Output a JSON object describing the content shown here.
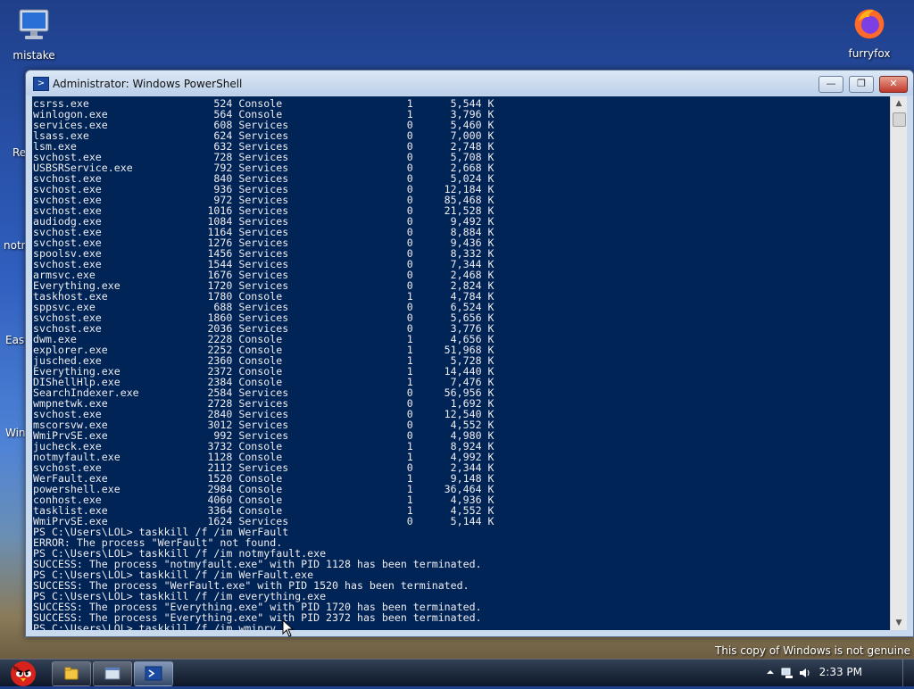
{
  "desktop": {
    "icons": [
      {
        "label": "mistake"
      },
      {
        "label": "furryfox"
      }
    ],
    "partial_labels": [
      "Re",
      "notn",
      "Easy",
      "Win"
    ],
    "genuine_notice": "This copy of Windows is not genuine"
  },
  "window": {
    "title": "Administrator: Windows PowerShell",
    "buttons": {
      "minimize": "—",
      "maximize": "❐",
      "close": "✕"
    },
    "console_lines": [
      "csrss.exe                    524 Console                    1      5,544 K",
      "winlogon.exe                 564 Console                    1      3,796 K",
      "services.exe                 608 Services                   0      5,460 K",
      "lsass.exe                    624 Services                   0      7,000 K",
      "lsm.exe                      632 Services                   0      2,748 K",
      "svchost.exe                  728 Services                   0      5,708 K",
      "USBSRService.exe             792 Services                   0      2,668 K",
      "svchost.exe                  840 Services                   0      5,024 K",
      "svchost.exe                  936 Services                   0     12,184 K",
      "svchost.exe                  972 Services                   0     85,468 K",
      "svchost.exe                 1016 Services                   0     21,528 K",
      "audiodg.exe                 1084 Services                   0      9,492 K",
      "svchost.exe                 1164 Services                   0      8,884 K",
      "svchost.exe                 1276 Services                   0      9,436 K",
      "spoolsv.exe                 1456 Services                   0      8,332 K",
      "svchost.exe                 1544 Services                   0      7,344 K",
      "armsvc.exe                  1676 Services                   0      2,468 K",
      "Everything.exe              1720 Services                   0      2,824 K",
      "taskhost.exe                1780 Console                    1      4,784 K",
      "sppsvc.exe                   688 Services                   0      6,524 K",
      "svchost.exe                 1860 Services                   0      5,656 K",
      "svchost.exe                 2036 Services                   0      3,776 K",
      "dwm.exe                     2228 Console                    1      4,656 K",
      "explorer.exe                2252 Console                    1     51,968 K",
      "jusched.exe                 2360 Console                    1      5,728 K",
      "Everything.exe              2372 Console                    1     14,440 K",
      "DIShellHlp.exe              2384 Console                    1      7,476 K",
      "SearchIndexer.exe           2584 Services                   0     56,956 K",
      "wmpnetwk.exe                2728 Services                   0      1,692 K",
      "svchost.exe                 2840 Services                   0     12,540 K",
      "mscorsvw.exe                3012 Services                   0      4,552 K",
      "WmiPrvSE.exe                 992 Services                   0      4,980 K",
      "jucheck.exe                 3732 Console                    1      8,924 K",
      "notmyfault.exe              1128 Console                    1      4,992 K",
      "svchost.exe                 2112 Services                   0      2,344 K",
      "WerFault.exe                1520 Console                    1      9,148 K",
      "powershell.exe              2984 Console                    1     36,464 K",
      "conhost.exe                 4060 Console                    1      4,936 K",
      "tasklist.exe                3364 Console                    1      4,552 K",
      "WmiPrvSE.exe                1624 Services                   0      5,144 K",
      "PS C:\\Users\\LOL> taskkill /f /im WerFault",
      "ERROR: The process \"WerFault\" not found.",
      "PS C:\\Users\\LOL> taskkill /f /im notmyfault.exe",
      "SUCCESS: The process \"notmyfault.exe\" with PID 1128 has been terminated.",
      "PS C:\\Users\\LOL> taskkill /f /im WerFault.exe",
      "SUCCESS: The process \"WerFault.exe\" with PID 1520 has been terminated.",
      "PS C:\\Users\\LOL> taskkill /f /im everything.exe",
      "SUCCESS: The process \"Everything.exe\" with PID 1720 has been terminated.",
      "SUCCESS: The process \"Everything.exe\" with PID 2372 has been terminated.",
      "PS C:\\Users\\LOL> taskkill /f /im wmiprv"
    ]
  },
  "taskbar": {
    "clock": "2:33 PM",
    "buttons": [
      {
        "name": "explorer-taskbar-button"
      },
      {
        "name": "window-taskbar-button"
      },
      {
        "name": "powershell-taskbar-button"
      }
    ]
  }
}
